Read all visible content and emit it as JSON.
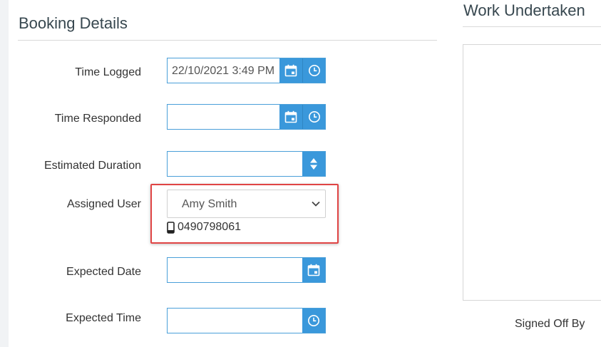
{
  "booking": {
    "title": "Booking Details",
    "fields": {
      "time_logged": {
        "label": "Time Logged",
        "value": "22/10/2021 3:49 PM"
      },
      "time_responded": {
        "label": "Time Responded",
        "value": ""
      },
      "estimated_duration": {
        "label": "Estimated Duration",
        "value": ""
      },
      "assigned_user": {
        "label": "Assigned User",
        "value": "Amy Smith",
        "phone": "0490798061"
      },
      "expected_date": {
        "label": "Expected Date",
        "value": ""
      },
      "expected_time": {
        "label": "Expected Time",
        "value": ""
      }
    }
  },
  "work": {
    "title": "Work Undertaken",
    "signed_off_label": "Signed Off By"
  },
  "icons": {
    "calendar": "calendar-icon",
    "clock": "clock-icon",
    "spinner": "spinner-updown-icon",
    "chevron": "chevron-down-icon",
    "phone": "mobile-phone-icon"
  },
  "colors": {
    "accent": "#3a98db",
    "highlight": "#e04444"
  }
}
